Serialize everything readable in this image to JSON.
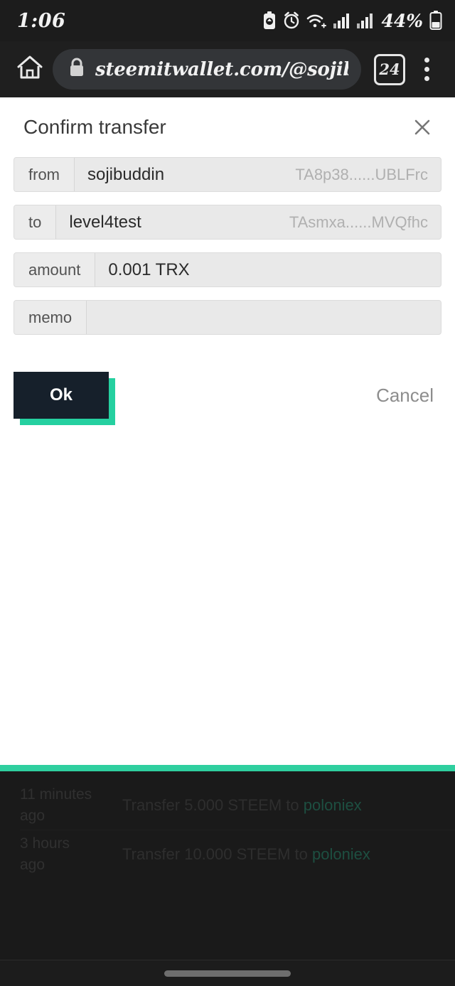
{
  "status_bar": {
    "time": "1:06",
    "battery_percent": "44%",
    "icons": [
      "battery-saver-icon",
      "alarm-icon",
      "wifi-icon",
      "signal-icon",
      "signal-icon",
      "battery-icon"
    ]
  },
  "browser": {
    "home_icon": "home-icon",
    "lock_icon": "lock-icon",
    "url": "steemitwallet.com/@sojibuddi",
    "tab_count": "24",
    "menu_icon": "overflow-menu-icon"
  },
  "modal": {
    "title": "Confirm transfer",
    "close_icon": "close-icon",
    "fields": [
      {
        "label": "from",
        "value": "sojibuddin",
        "address": "TA8p38......UBLFrc"
      },
      {
        "label": "to",
        "value": "level4test",
        "address": "TAsmxa......MVQfhc"
      },
      {
        "label": "amount",
        "value": "0.001  TRX",
        "address": ""
      },
      {
        "label": "memo",
        "value": "",
        "address": ""
      }
    ],
    "ok_label": "Ok",
    "cancel_label": "Cancel"
  },
  "history": [
    {
      "time": "11 minutes ago",
      "text_before": "Transfer 5.000 STEEM to ",
      "link": "poloniex"
    },
    {
      "time": "3 hours ago",
      "text_before": "Transfer 10.000 STEEM to ",
      "link": "poloniex"
    }
  ],
  "colors": {
    "accent_teal": "#2fcf9f",
    "button_dark": "#16202b",
    "status_bg": "#1c1c1c",
    "toolbar_bg": "#1f1f1f",
    "field_bg": "#e9e9e9"
  }
}
